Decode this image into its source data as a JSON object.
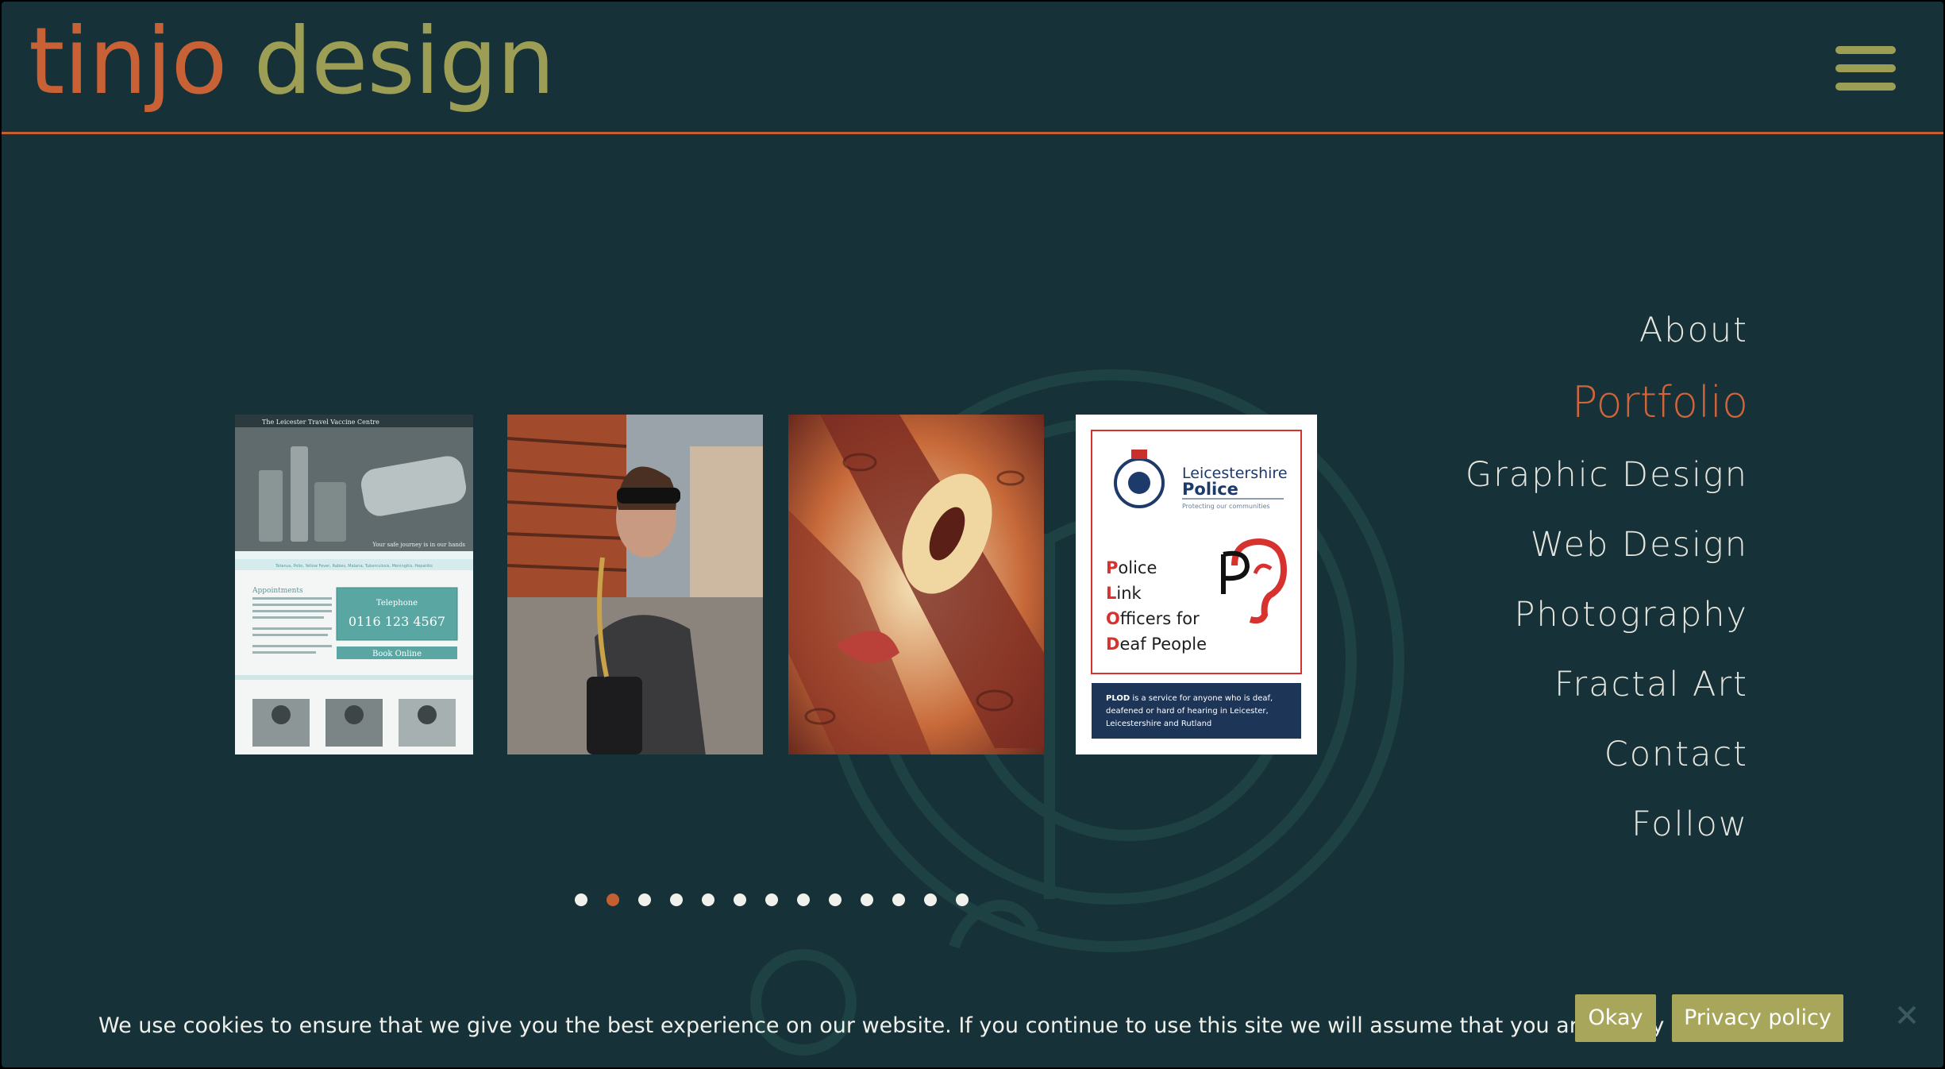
{
  "logo": {
    "part1": "tinjo",
    "part2": "design"
  },
  "menu": {
    "icon": "hamburger-menu-icon"
  },
  "nav": {
    "items": [
      {
        "label": "About",
        "active": false
      },
      {
        "label": "Portfolio",
        "active": true
      },
      {
        "label": "Graphic Design",
        "active": false
      },
      {
        "label": "Web Design",
        "active": false
      },
      {
        "label": "Photography",
        "active": false
      },
      {
        "label": "Fractal Art",
        "active": false
      },
      {
        "label": "Contact",
        "active": false
      },
      {
        "label": "Follow",
        "active": false
      }
    ]
  },
  "carousel": {
    "slides": [
      {
        "name": "travel-vaccine-website",
        "site_title": "The Leicester Travel Vaccine Centre",
        "tagline": "Your safe journey is in our hands",
        "vaccine_list": "Tetanus, Polio, Yellow Fever, Rabies, Malaria, Tuberculosis, Meningitis, Hepatitis",
        "appointments_heading": "Appointments",
        "telephone_label": "Telephone",
        "telephone_number": "0116 123 4567",
        "book_button": "Book Online"
      },
      {
        "name": "portrait-photo"
      },
      {
        "name": "fractal-art"
      },
      {
        "name": "police-poster",
        "org_line1": "Leicestershire",
        "org_line2": "Police",
        "org_tagline": "Protecting our communities",
        "acronym_lines": [
          {
            "initial": "P",
            "rest": "olice"
          },
          {
            "initial": "L",
            "rest": "ink"
          },
          {
            "initial": "O",
            "rest": "fficers for"
          },
          {
            "initial": "D",
            "rest": "eaf People"
          }
        ],
        "footer_bold": "PLOD",
        "footer_lines": [
          " is a service for anyone who is deaf,",
          "deafened or hard of hearing in Leicester,",
          "Leicestershire and Rutland"
        ]
      }
    ],
    "dot_count": 13,
    "active_dot": 1
  },
  "cookie": {
    "message": "We use cookies to ensure that we give you the best experience on our website. If you continue to use this site we will assume that you are happy with it.",
    "okay_label": "Okay",
    "privacy_label": "Privacy policy",
    "close_icon": "close-icon"
  },
  "colors": {
    "background": "#163238",
    "accent_orange": "#c86236",
    "accent_olive": "#9d9e55",
    "button_olive": "#a8a65a",
    "nav_text": "#e6e6de"
  }
}
